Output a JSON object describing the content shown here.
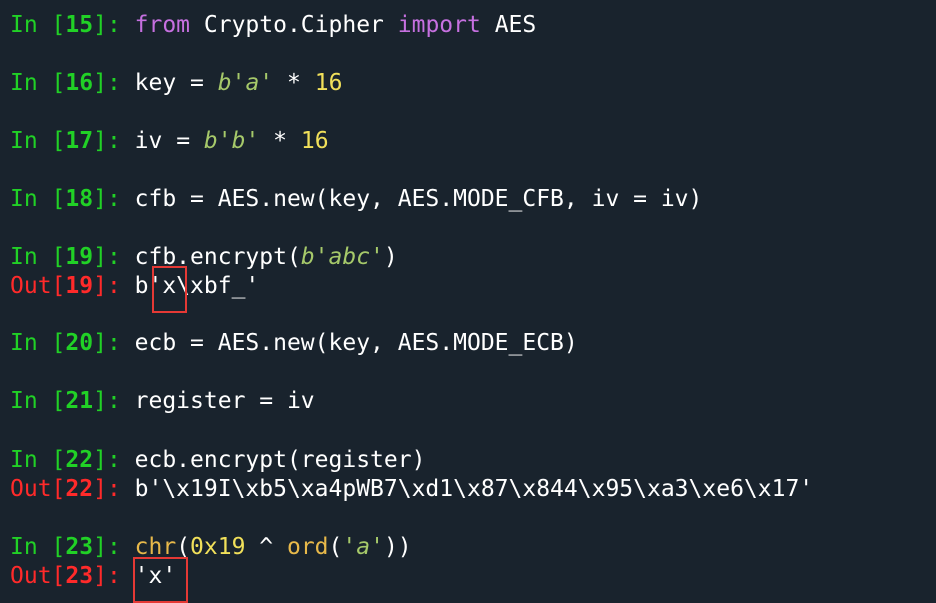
{
  "cells": [
    {
      "prompt_in": "In [",
      "num": "15",
      "prompt_end": "]: ",
      "tokens": [
        {
          "t": "from",
          "c": "kw"
        },
        {
          "t": " Crypto.Cipher ",
          "c": "plain"
        },
        {
          "t": "import",
          "c": "kw"
        },
        {
          "t": " AES",
          "c": "plain"
        }
      ]
    },
    {
      "prompt_in": "In [",
      "num": "16",
      "prompt_end": "]: ",
      "tokens": [
        {
          "t": "key ",
          "c": "plain"
        },
        {
          "t": "=",
          "c": "op"
        },
        {
          "t": " ",
          "c": "plain"
        },
        {
          "t": "b'a'",
          "c": "str"
        },
        {
          "t": " ",
          "c": "plain"
        },
        {
          "t": "*",
          "c": "op"
        },
        {
          "t": " ",
          "c": "plain"
        },
        {
          "t": "16",
          "c": "num"
        }
      ]
    },
    {
      "prompt_in": "In [",
      "num": "17",
      "prompt_end": "]: ",
      "tokens": [
        {
          "t": "iv ",
          "c": "plain"
        },
        {
          "t": "=",
          "c": "op"
        },
        {
          "t": " ",
          "c": "plain"
        },
        {
          "t": "b'b'",
          "c": "str"
        },
        {
          "t": " ",
          "c": "plain"
        },
        {
          "t": "*",
          "c": "op"
        },
        {
          "t": " ",
          "c": "plain"
        },
        {
          "t": "16",
          "c": "num"
        }
      ]
    },
    {
      "prompt_in": "In [",
      "num": "18",
      "prompt_end": "]: ",
      "tokens": [
        {
          "t": "cfb = AES.new(key, AES.MODE_CFB, iv = iv)",
          "c": "plain"
        }
      ]
    },
    {
      "prompt_in": "In [",
      "num": "19",
      "prompt_end": "]: ",
      "tokens": [
        {
          "t": "cfb.encrypt(",
          "c": "plain"
        },
        {
          "t": "b'abc'",
          "c": "str"
        },
        {
          "t": ")",
          "c": "plain"
        }
      ],
      "out_prompt": "Out[",
      "out_end": "]: ",
      "output": "b'x\\xbf_'"
    },
    {
      "prompt_in": "In [",
      "num": "20",
      "prompt_end": "]: ",
      "tokens": [
        {
          "t": "ecb = AES.new(key, AES.MODE_ECB)",
          "c": "plain"
        }
      ]
    },
    {
      "prompt_in": "In [",
      "num": "21",
      "prompt_end": "]: ",
      "tokens": [
        {
          "t": "register = iv",
          "c": "plain"
        }
      ]
    },
    {
      "prompt_in": "In [",
      "num": "22",
      "prompt_end": "]: ",
      "tokens": [
        {
          "t": "ecb.encrypt(register)",
          "c": "plain"
        }
      ],
      "out_prompt": "Out[",
      "out_end": "]: ",
      "output": "b'\\x19I\\xb5\\xa4pWB7\\xd1\\x87\\x844\\x95\\xa3\\xe6\\x17'"
    },
    {
      "prompt_in": "In [",
      "num": "23",
      "prompt_end": "]: ",
      "tokens": [
        {
          "t": "chr",
          "c": "builtin"
        },
        {
          "t": "(",
          "c": "plain"
        },
        {
          "t": "0x19",
          "c": "num"
        },
        {
          "t": " ^ ",
          "c": "plain"
        },
        {
          "t": "ord",
          "c": "builtin"
        },
        {
          "t": "(",
          "c": "plain"
        },
        {
          "t": "'a'",
          "c": "str"
        },
        {
          "t": "))",
          "c": "plain"
        }
      ],
      "out_prompt": "Out[",
      "out_end": "]: ",
      "output": "'x'"
    }
  ],
  "colors": {
    "background": "#19232d",
    "in_prompt": "#21d126",
    "out_prompt": "#ff2a2a",
    "keyword": "#c670e0",
    "string": "#a6c96a",
    "number": "#f1e05a",
    "builtin": "#e8b94a",
    "highlight_box": "#e53935"
  }
}
